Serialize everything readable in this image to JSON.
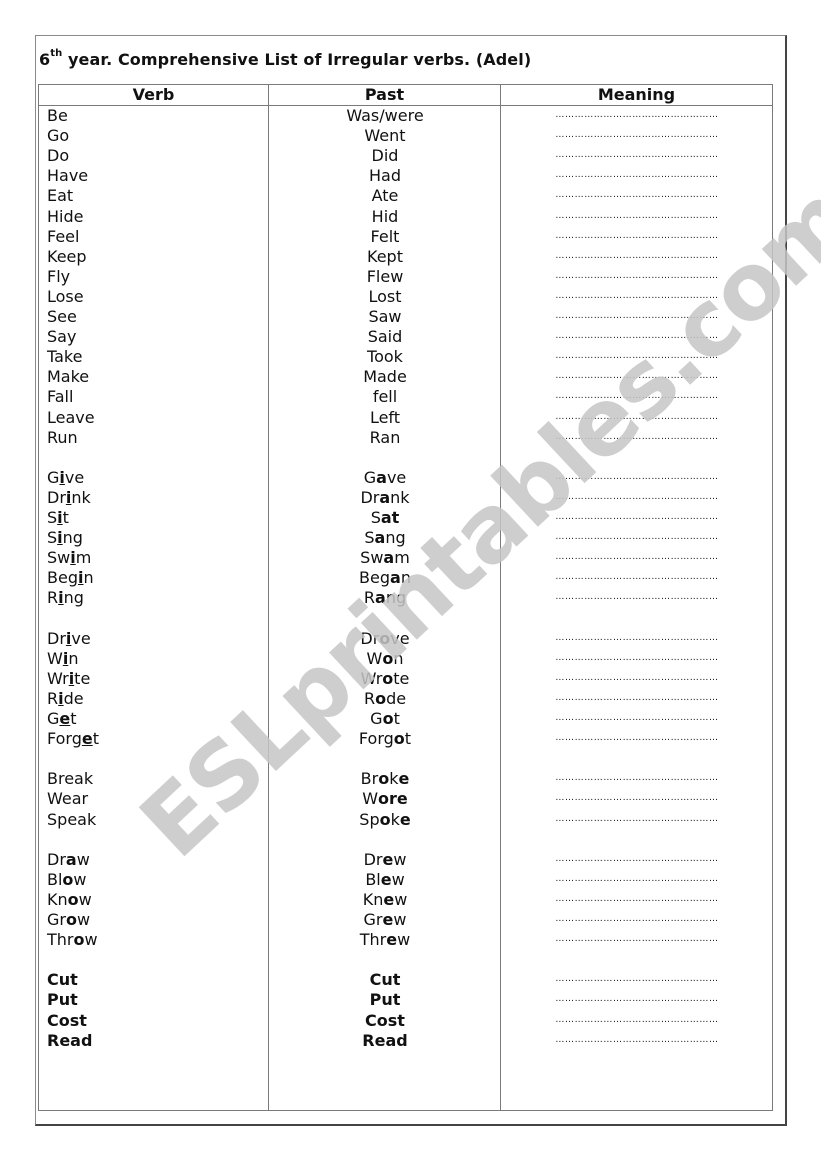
{
  "document": {
    "title_prefix": "6",
    "title_sup": "th",
    "title_rest": " year. Comprehensive List of Irregular verbs. (Adel)",
    "watermark": "ESLprintables.com"
  },
  "table": {
    "headers": [
      "Verb",
      "Past",
      "Meaning"
    ],
    "blank_placeholder": "……………………………………………",
    "rows": [
      {
        "slot": 0,
        "verb": [
          [
            "Be",
            ""
          ]
        ],
        "past": [
          [
            "Was/were",
            ""
          ]
        ]
      },
      {
        "slot": 1,
        "verb": [
          [
            "Go",
            ""
          ]
        ],
        "past": [
          [
            "Went",
            ""
          ]
        ]
      },
      {
        "slot": 2,
        "verb": [
          [
            "Do",
            ""
          ]
        ],
        "past": [
          [
            "Did",
            ""
          ]
        ]
      },
      {
        "slot": 3,
        "verb": [
          [
            "Have",
            ""
          ]
        ],
        "past": [
          [
            "Had",
            ""
          ]
        ]
      },
      {
        "slot": 4,
        "verb": [
          [
            "Eat",
            ""
          ]
        ],
        "past": [
          [
            "Ate",
            ""
          ]
        ]
      },
      {
        "slot": 5,
        "verb": [
          [
            "Hide",
            ""
          ]
        ],
        "past": [
          [
            "Hid",
            ""
          ]
        ]
      },
      {
        "slot": 6,
        "verb": [
          [
            "Feel",
            ""
          ]
        ],
        "past": [
          [
            "Felt",
            ""
          ]
        ]
      },
      {
        "slot": 7,
        "verb": [
          [
            "Keep",
            ""
          ]
        ],
        "past": [
          [
            "Kept",
            ""
          ]
        ]
      },
      {
        "slot": 8,
        "verb": [
          [
            "Fly",
            ""
          ]
        ],
        "past": [
          [
            "Flew",
            ""
          ]
        ]
      },
      {
        "slot": 9,
        "verb": [
          [
            "Lose",
            ""
          ]
        ],
        "past": [
          [
            "Lost",
            ""
          ]
        ]
      },
      {
        "slot": 10,
        "verb": [
          [
            "See",
            ""
          ]
        ],
        "past": [
          [
            "Saw",
            ""
          ]
        ]
      },
      {
        "slot": 11,
        "verb": [
          [
            "Say",
            ""
          ]
        ],
        "past": [
          [
            "Said",
            ""
          ]
        ]
      },
      {
        "slot": 12,
        "verb": [
          [
            "Take",
            ""
          ]
        ],
        "past": [
          [
            "Took",
            ""
          ]
        ]
      },
      {
        "slot": 13,
        "verb": [
          [
            "Make",
            ""
          ]
        ],
        "past": [
          [
            "Made",
            ""
          ]
        ]
      },
      {
        "slot": 14,
        "verb": [
          [
            "Fall",
            ""
          ]
        ],
        "past": [
          [
            "fell",
            ""
          ]
        ]
      },
      {
        "slot": 15,
        "verb": [
          [
            "Leave",
            ""
          ]
        ],
        "past": [
          [
            "Left",
            ""
          ]
        ]
      },
      {
        "slot": 16,
        "verb": [
          [
            "Run",
            ""
          ]
        ],
        "past": [
          [
            "Ran",
            ""
          ]
        ]
      },
      {
        "slot": 18,
        "verb": [
          [
            "G",
            ""
          ],
          [
            "i",
            "ul"
          ],
          [
            "ve",
            ""
          ]
        ],
        "past": [
          [
            "G",
            ""
          ],
          [
            "a",
            "hl"
          ],
          [
            "ve",
            ""
          ]
        ]
      },
      {
        "slot": 19,
        "verb": [
          [
            "Dr",
            ""
          ],
          [
            "i",
            "ul"
          ],
          [
            "nk",
            ""
          ]
        ],
        "past": [
          [
            "Dr",
            ""
          ],
          [
            "a",
            "hl"
          ],
          [
            "nk",
            ""
          ]
        ]
      },
      {
        "slot": 20,
        "verb": [
          [
            "S",
            ""
          ],
          [
            "i",
            "ul"
          ],
          [
            "t",
            ""
          ]
        ],
        "past": [
          [
            "S",
            ""
          ],
          [
            "at",
            "hl"
          ]
        ]
      },
      {
        "slot": 21,
        "verb": [
          [
            "S",
            ""
          ],
          [
            "i",
            "ul"
          ],
          [
            "ng",
            ""
          ]
        ],
        "past": [
          [
            "S",
            ""
          ],
          [
            "a",
            "hl"
          ],
          [
            "ng",
            ""
          ]
        ]
      },
      {
        "slot": 22,
        "verb": [
          [
            "Sw",
            ""
          ],
          [
            "i",
            "ul"
          ],
          [
            "m",
            ""
          ]
        ],
        "past": [
          [
            "Sw",
            ""
          ],
          [
            "a",
            "hl"
          ],
          [
            "m",
            ""
          ]
        ]
      },
      {
        "slot": 23,
        "verb": [
          [
            "Beg",
            ""
          ],
          [
            "i",
            "ul"
          ],
          [
            "n",
            ""
          ]
        ],
        "past": [
          [
            "Beg",
            ""
          ],
          [
            "a",
            "hl"
          ],
          [
            "n",
            ""
          ]
        ]
      },
      {
        "slot": 24,
        "verb": [
          [
            "R",
            ""
          ],
          [
            "i",
            "ul"
          ],
          [
            "ng",
            ""
          ]
        ],
        "past": [
          [
            "R",
            ""
          ],
          [
            "a",
            "hl"
          ],
          [
            "ng",
            ""
          ]
        ]
      },
      {
        "slot": 26,
        "verb": [
          [
            "Dr",
            ""
          ],
          [
            "i",
            "ul"
          ],
          [
            "ve",
            ""
          ]
        ],
        "past": [
          [
            "Dr",
            ""
          ],
          [
            "o",
            "hl"
          ],
          [
            "ve",
            ""
          ]
        ]
      },
      {
        "slot": 27,
        "verb": [
          [
            "W",
            ""
          ],
          [
            "i",
            "ul"
          ],
          [
            "n",
            ""
          ]
        ],
        "past": [
          [
            "W",
            ""
          ],
          [
            "o",
            "hl"
          ],
          [
            "n",
            ""
          ]
        ]
      },
      {
        "slot": 28,
        "verb": [
          [
            "Wr",
            ""
          ],
          [
            "i",
            "ul"
          ],
          [
            "te",
            ""
          ]
        ],
        "past": [
          [
            "Wr",
            ""
          ],
          [
            "o",
            "hl"
          ],
          [
            "te",
            ""
          ]
        ]
      },
      {
        "slot": 29,
        "verb": [
          [
            "R",
            ""
          ],
          [
            "i",
            "ul"
          ],
          [
            "de",
            ""
          ]
        ],
        "past": [
          [
            "R",
            ""
          ],
          [
            "o",
            "hl"
          ],
          [
            "de",
            ""
          ]
        ]
      },
      {
        "slot": 30,
        "verb": [
          [
            "G",
            ""
          ],
          [
            "e",
            "ul"
          ],
          [
            "t",
            ""
          ]
        ],
        "past": [
          [
            "G",
            ""
          ],
          [
            "o",
            "hl"
          ],
          [
            "t",
            ""
          ]
        ]
      },
      {
        "slot": 31,
        "verb": [
          [
            "Forg",
            ""
          ],
          [
            "e",
            "ul"
          ],
          [
            "t",
            ""
          ]
        ],
        "past": [
          [
            "Forg",
            ""
          ],
          [
            "o",
            "hl"
          ],
          [
            "t",
            ""
          ]
        ]
      },
      {
        "slot": 33,
        "verb": [
          [
            "Break",
            ""
          ]
        ],
        "past": [
          [
            "Br",
            ""
          ],
          [
            "o",
            "hl"
          ],
          [
            "k",
            ""
          ],
          [
            "e",
            "hl"
          ]
        ]
      },
      {
        "slot": 34,
        "verb": [
          [
            "Wear",
            ""
          ]
        ],
        "past": [
          [
            "W",
            ""
          ],
          [
            "ore",
            "hl"
          ]
        ]
      },
      {
        "slot": 35,
        "verb": [
          [
            "Speak",
            ""
          ]
        ],
        "past": [
          [
            "Sp",
            ""
          ],
          [
            "o",
            "hl"
          ],
          [
            "k",
            ""
          ],
          [
            "e",
            "hl"
          ]
        ]
      },
      {
        "slot": 37,
        "verb": [
          [
            "Dr",
            ""
          ],
          [
            "a",
            "hl"
          ],
          [
            "w",
            ""
          ]
        ],
        "past": [
          [
            "Dr",
            ""
          ],
          [
            "e",
            "hl"
          ],
          [
            "w",
            ""
          ]
        ]
      },
      {
        "slot": 38,
        "verb": [
          [
            "Bl",
            ""
          ],
          [
            "o",
            "hl"
          ],
          [
            "w",
            ""
          ]
        ],
        "past": [
          [
            "Bl",
            ""
          ],
          [
            "e",
            "hl"
          ],
          [
            "w",
            ""
          ]
        ]
      },
      {
        "slot": 39,
        "verb": [
          [
            "Kn",
            ""
          ],
          [
            "o",
            "hl"
          ],
          [
            "w",
            ""
          ]
        ],
        "past": [
          [
            "Kn",
            ""
          ],
          [
            "e",
            "hl"
          ],
          [
            "w",
            ""
          ]
        ]
      },
      {
        "slot": 40,
        "verb": [
          [
            "Gr",
            ""
          ],
          [
            "o",
            "hl"
          ],
          [
            "w",
            ""
          ]
        ],
        "past": [
          [
            "Gr",
            ""
          ],
          [
            "e",
            "hl"
          ],
          [
            "w",
            ""
          ]
        ]
      },
      {
        "slot": 41,
        "verb": [
          [
            "Thr",
            ""
          ],
          [
            "o",
            "hl"
          ],
          [
            "w",
            ""
          ]
        ],
        "past": [
          [
            "Thr",
            ""
          ],
          [
            "e",
            "hl"
          ],
          [
            "w",
            ""
          ]
        ]
      },
      {
        "slot": 43,
        "verb": [
          [
            "Cut",
            "allbold"
          ]
        ],
        "past": [
          [
            "Cut",
            "allbold"
          ]
        ]
      },
      {
        "slot": 44,
        "verb": [
          [
            "Put",
            "allbold"
          ]
        ],
        "past": [
          [
            "Put",
            "allbold"
          ]
        ]
      },
      {
        "slot": 45,
        "verb": [
          [
            "Cost",
            "allbold"
          ]
        ],
        "past": [
          [
            "Cost",
            "allbold"
          ]
        ]
      },
      {
        "slot": 46,
        "verb": [
          [
            "Read",
            "allbold"
          ]
        ],
        "past": [
          [
            "Read",
            "allbold"
          ]
        ]
      }
    ]
  }
}
